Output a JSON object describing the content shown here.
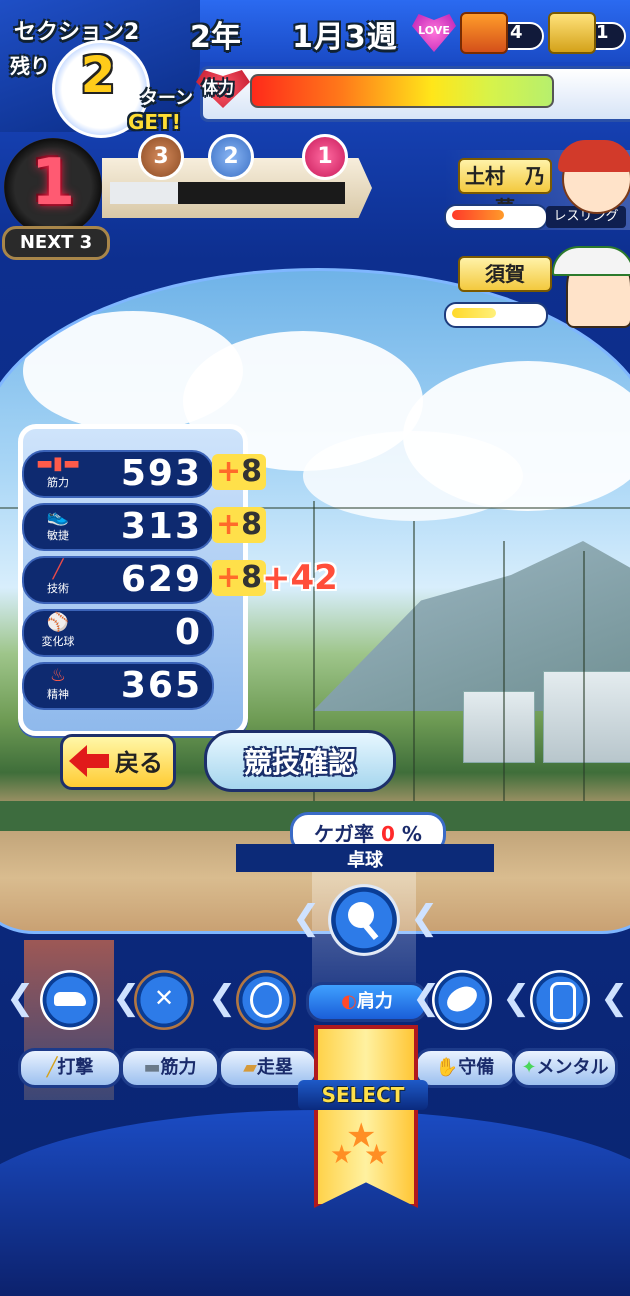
{
  "header": {
    "section_label": "セクション2",
    "remaining_label": "残り",
    "remaining_turns": "2",
    "turn_label": "ターン",
    "year": "2年",
    "month_week": "1月3週",
    "love_label": "LOVE",
    "chest_count_a": "4",
    "chest_count_b": "1",
    "stamina_label": "体力",
    "stamina_level": 0.98
  },
  "rank": {
    "get_label": "GET!",
    "current": "1",
    "next_label": "NEXT 3",
    "medals": [
      "3",
      "2",
      "1"
    ]
  },
  "characters": [
    {
      "name": "土村　乃夢",
      "tag": "レスリング",
      "gauge_level": 0.55
    },
    {
      "name": "須賀",
      "tag": "",
      "gauge_level": 0.45
    }
  ],
  "stats": [
    {
      "icon": "dumbbell-icon",
      "label": "筋力",
      "value": "593",
      "bonus": "8",
      "extra": ""
    },
    {
      "icon": "shoe-icon",
      "label": "敏捷",
      "value": "313",
      "bonus": "8",
      "extra": ""
    },
    {
      "icon": "bat-icon",
      "label": "技術",
      "value": "629",
      "bonus": "8",
      "extra": "42"
    },
    {
      "icon": "curveball-icon",
      "label": "変化球",
      "value": "0",
      "bonus": "",
      "extra": ""
    },
    {
      "icon": "spirit-icon",
      "label": "精神",
      "value": "365",
      "bonus": "",
      "extra": ""
    }
  ],
  "buttons": {
    "back": "戻る",
    "confirm": "競技確認"
  },
  "training": {
    "injury_label": "ケガ率",
    "injury_value": "0",
    "injury_unit": "%",
    "selected_name": "卓球",
    "selected_tag": "肩力",
    "select_label": "SELECT",
    "options": [
      {
        "icon": "shoe-icon",
        "label": "打撃"
      },
      {
        "icon": "fencing-icon",
        "label": "筋力"
      },
      {
        "icon": "tennis-icon",
        "label": "走塁"
      },
      {
        "icon": "table-tennis-icon",
        "label": "肩力"
      },
      {
        "icon": "rugby-icon",
        "label": "守備"
      },
      {
        "icon": "wrestling-icon",
        "label": "メンタル"
      }
    ]
  },
  "colors": {
    "accent_red": "#ff3a2a",
    "bonus_yellow": "#ffe04a",
    "panel_blue": "#0e2a70"
  }
}
